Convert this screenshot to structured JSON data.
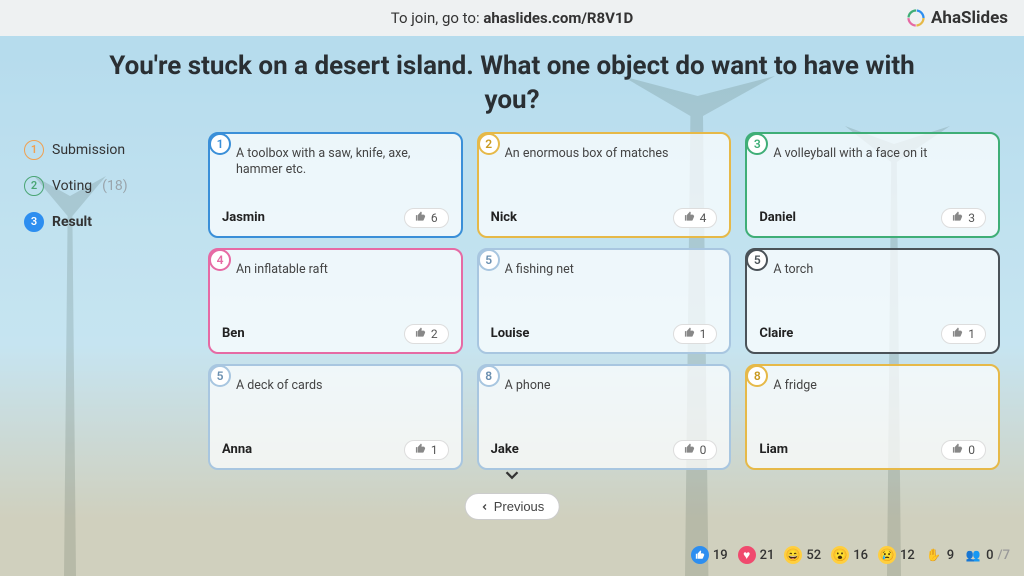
{
  "topbar": {
    "prefix": "To join, go to: ",
    "url": "ahaslides.com/R8V1D"
  },
  "brand": "AhaSlides",
  "question": "You're stuck on a desert island. What one object do want to have with you?",
  "steps": {
    "submission": {
      "num": "1",
      "label": "Submission"
    },
    "voting": {
      "num": "2",
      "label": "Voting",
      "count": "(18)"
    },
    "result": {
      "num": "3",
      "label": "Result"
    }
  },
  "cards": [
    {
      "rank": "1",
      "answer": "A toolbox with a saw, knife, axe, hammer etc.",
      "author": "Jasmin",
      "votes": "6",
      "color": "c-blue"
    },
    {
      "rank": "2",
      "answer": "An enormous box of matches",
      "author": "Nick",
      "votes": "4",
      "color": "c-yellow"
    },
    {
      "rank": "3",
      "answer": "A volleyball with a face on it",
      "author": "Daniel",
      "votes": "3",
      "color": "c-green"
    },
    {
      "rank": "4",
      "answer": "An inflatable raft",
      "author": "Ben",
      "votes": "2",
      "color": "c-pink"
    },
    {
      "rank": "5",
      "answer": "A fishing net",
      "author": "Louise",
      "votes": "1",
      "color": "c-light"
    },
    {
      "rank": "5",
      "answer": "A torch",
      "author": "Claire",
      "votes": "1",
      "color": "c-dark"
    },
    {
      "rank": "5",
      "answer": "A deck of cards",
      "author": "Anna",
      "votes": "1",
      "color": "c-light"
    },
    {
      "rank": "8",
      "answer": "A phone",
      "author": "Jake",
      "votes": "0",
      "color": "c-light"
    },
    {
      "rank": "8",
      "answer": "A fridge",
      "author": "Liam",
      "votes": "0",
      "color": "c-yellow"
    }
  ],
  "buttons": {
    "previous": "Previous"
  },
  "reactions": {
    "like": "19",
    "love": "21",
    "laugh": "52",
    "wow": "16",
    "sad": "12",
    "hand": "9",
    "participants_current": "0",
    "participants_total": "/7"
  }
}
